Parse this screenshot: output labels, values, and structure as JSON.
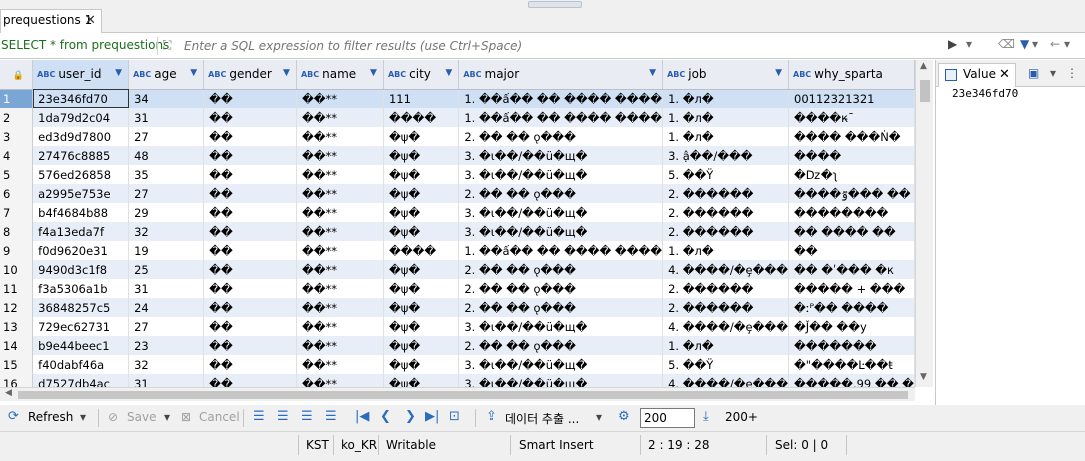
{
  "editor_tab": {
    "label": "prequestions 1"
  },
  "filter": {
    "sql": "SELECT * from prequestions",
    "placeholder": "Enter a SQL expression to filter results (use Ctrl+Space)"
  },
  "grid": {
    "columns": [
      {
        "label": "user_id"
      },
      {
        "label": "age"
      },
      {
        "label": "gender"
      },
      {
        "label": "name"
      },
      {
        "label": "city"
      },
      {
        "label": "major"
      },
      {
        "label": "job"
      },
      {
        "label": "why_sparta"
      }
    ],
    "rows": [
      {
        "n": "1",
        "c": [
          "23e346fd70",
          "34",
          "��",
          "��**",
          "111",
          "1. ��ấ�� �� ���� ����",
          "1. �л�",
          "00112321321"
        ]
      },
      {
        "n": "2",
        "c": [
          "1da79d2c04",
          "31",
          "��",
          "��**",
          "����",
          "1. ��ấ�� �� ���� ����",
          "1. �л�",
          "����к̵¯"
        ]
      },
      {
        "n": "3",
        "c": [
          "ed3d9d7800",
          "27",
          "��",
          "��**",
          "�ψ�",
          "2. �� �� ǫ���",
          "1. �л�",
          "���� ���Ṅ�"
        ]
      },
      {
        "n": "4",
        "c": [
          "27476c8885",
          "48",
          "��",
          "��**",
          "�ψ�",
          "3. �ι��/��ü�щ�",
          "3. ậ��/���",
          "����"
        ]
      },
      {
        "n": "5",
        "c": [
          "576ed26858",
          "35",
          "��",
          "��**",
          "�ψ�",
          "3. �ι��/��ü�щ�",
          "5. ��Ÿ",
          "�ǲ�ʅ"
        ]
      },
      {
        "n": "6",
        "c": [
          "a2995e753e",
          "27",
          "��",
          "��**",
          "�ψ�",
          "2. �� �� ǫ���",
          "2. ������",
          "����ٷ��� ��"
        ]
      },
      {
        "n": "7",
        "c": [
          "b4f4684b88",
          "29",
          "��",
          "��**",
          "�ψ�",
          "3. �ι��/��ü�щ�",
          "2. ������",
          "��������"
        ]
      },
      {
        "n": "8",
        "c": [
          "f4a13eda7f",
          "32",
          "��",
          "��**",
          "�ψ�",
          "3. �ι��/��ü�щ�",
          "2. ������",
          "�� ���� ��"
        ]
      },
      {
        "n": "9",
        "c": [
          "f0d9620e31",
          "19",
          "��",
          "��**",
          "����",
          "1. ��ấ�� �� ���� ����",
          "1. �л�",
          "��"
        ]
      },
      {
        "n": "10",
        "c": [
          "9490d3c1f8",
          "25",
          "��",
          "��**",
          "�ψ�",
          "2. �� �� ǫ���",
          "4. ����/�ȩ���",
          "�� �ʹ��� �к"
        ]
      },
      {
        "n": "11",
        "c": [
          "f3a5306a1b",
          "31",
          "��",
          "��**",
          "�ψ�",
          "2. �� �� ǫ���",
          "2. ������",
          "����� + ���"
        ]
      },
      {
        "n": "12",
        "c": [
          "36848257c5",
          "24",
          "��",
          "��**",
          "�ψ�",
          "2. �� �� ǫ���",
          "2. ������",
          "�ːᴾ�� ����"
        ]
      },
      {
        "n": "13",
        "c": [
          "729ec62731",
          "27",
          "��",
          "��**",
          "�ψ�",
          "3. �ι��/��ü�щ�",
          "4. ����/�ȩ���",
          "�J̌��  ��y"
        ]
      },
      {
        "n": "14",
        "c": [
          "b9e44beec1",
          "23",
          "��",
          "��**",
          "�ψ�",
          "2. �� �� ǫ���",
          "1. �л�",
          "�������"
        ]
      },
      {
        "n": "15",
        "c": [
          "f40dabf46a",
          "32",
          "��",
          "��**",
          "�ψ�",
          "3. �ι��/��ü�щ�",
          "5. ��Ÿ",
          "�\"����Ŀ��ŧ"
        ]
      },
      {
        "n": "16",
        "c": [
          "d7527db4ac",
          "31",
          "��",
          "��**",
          "�ψ�",
          "3. �ι��/��ü�щ�",
          "4. ����/�ȩ���",
          "�����.99 �� �"
        ]
      }
    ]
  },
  "value_panel": {
    "tab_label": "Value",
    "content": "23e346fd70"
  },
  "toolbar": {
    "refresh_label": "Refresh",
    "save_label": "Save",
    "cancel_label": "Cancel",
    "export_label": "데이터 추출 ...",
    "fetch_size": "200",
    "fetch_more_label": "200+"
  },
  "status": {
    "timezone": "KST",
    "locale": "ko_KR",
    "mode": "Writable",
    "insert_mode": "Smart Insert",
    "cursor": "2 : 19 : 28",
    "selection": "Sel: 0 | 0"
  },
  "colors": {
    "accent": "#2a5db0",
    "selected_row": "#cfe0f4",
    "alt_row": "#e8eef7",
    "sql_text": "#1a6e1a"
  }
}
